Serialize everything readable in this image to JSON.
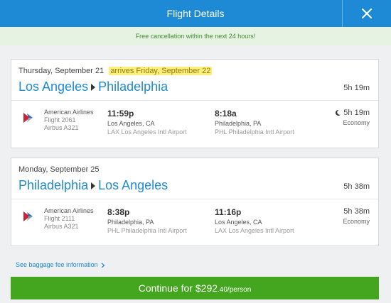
{
  "header": {
    "title": "Flight Details"
  },
  "banner": {
    "text": "Free cancellation within the next 24 hours!"
  },
  "flights": [
    {
      "date": "Thursday, September 21",
      "arrives_note": "arrives Friday, September 22",
      "origin_city": "Los Angeles",
      "destination_city": "Philadelphia",
      "total_duration": "5h 19m",
      "segment": {
        "airline": "American Airlines",
        "flight": "Flight 2061",
        "aircraft": "Airbus A321",
        "depart_time": "11:59p",
        "depart_city": "Los Angeles, CA",
        "depart_airport": "LAX Los Angeles Intl Airport",
        "arrive_time": "8:18a",
        "arrive_city": "Philadelphia, PA",
        "arrive_airport": "PHL Philadelphia Intl Airport",
        "duration": "5h 19m",
        "cabin": "Economy",
        "overnight": true
      }
    },
    {
      "date": "Monday, September 25",
      "origin_city": "Philadelphia",
      "destination_city": "Los Angeles",
      "total_duration": "5h 38m",
      "segment": {
        "airline": "American Airlines",
        "flight": "Flight 2111",
        "aircraft": "Airbus A321",
        "depart_time": "8:38p",
        "depart_city": "Philadelphia, PA",
        "depart_airport": "PHL Philadelphia Intl Airport",
        "arrive_time": "11:16p",
        "arrive_city": "Los Angeles, CA",
        "arrive_airport": "LAX Los Angeles Intl Airport",
        "duration": "5h 38m",
        "cabin": "Economy",
        "overnight": false
      }
    }
  ],
  "baggage_link": "See baggage fee information",
  "continue": {
    "prefix": "Continue for ",
    "price_main": "$292",
    "price_tail": ".40/person"
  },
  "colors": {
    "header": "#1e8ad6",
    "route": "#1e8ad6",
    "continue": "#44a51f",
    "banner_text": "#3d8f2a",
    "highlight": "#ffee7a"
  },
  "icons": {
    "close": "close-icon",
    "airline_logo": "american-airlines-logo",
    "route_arrow": "triangle-right-icon",
    "overnight": "moon-icon",
    "chevron": "chevron-right-icon"
  }
}
